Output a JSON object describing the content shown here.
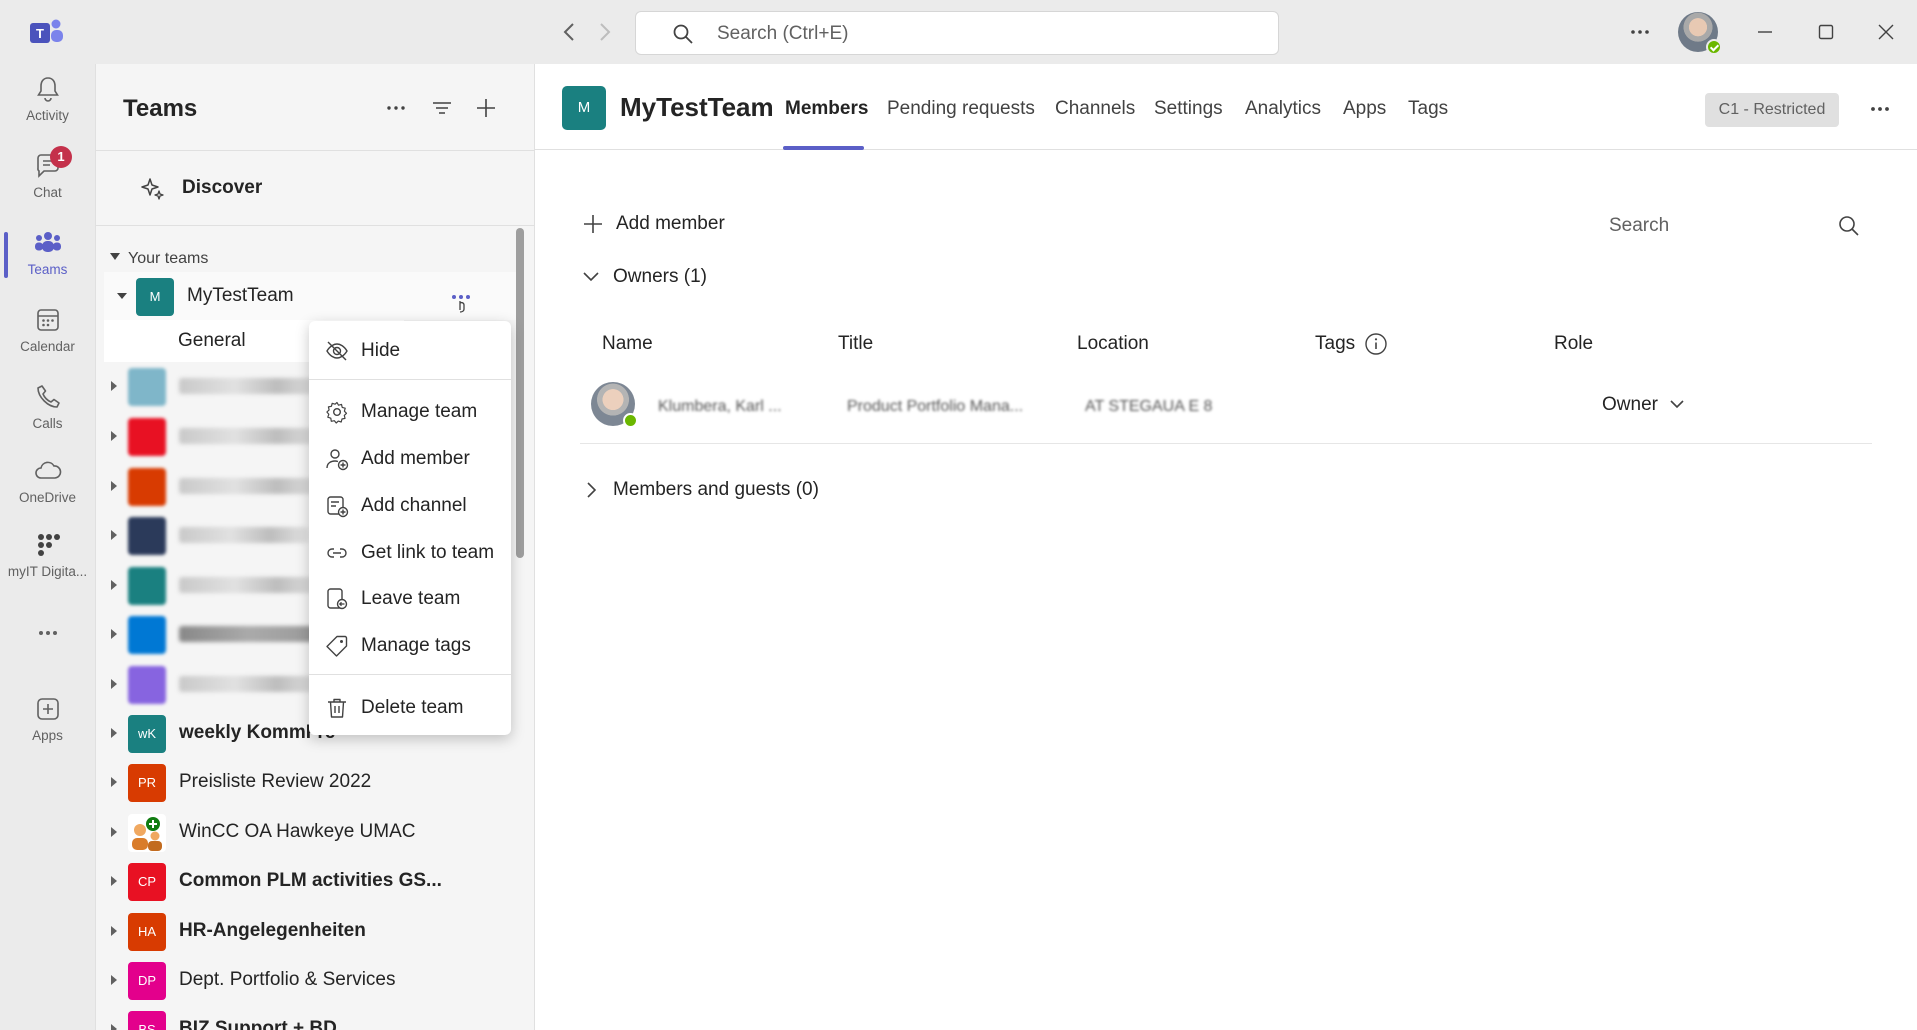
{
  "titlebar": {
    "search_placeholder": "Search (Ctrl+E)"
  },
  "rail": {
    "items": [
      {
        "label": "Activity",
        "icon": "bell-icon"
      },
      {
        "label": "Chat",
        "icon": "chat-icon",
        "badge": "1"
      },
      {
        "label": "Teams",
        "icon": "teams-icon",
        "active": true
      },
      {
        "label": "Calendar",
        "icon": "calendar-icon"
      },
      {
        "label": "Calls",
        "icon": "phone-icon"
      },
      {
        "label": "OneDrive",
        "icon": "cloud-icon"
      },
      {
        "label": "myIT Digita...",
        "icon": "app-grid-icon"
      },
      {
        "label": "Apps",
        "icon": "add-app-icon"
      }
    ]
  },
  "panel": {
    "title": "Teams",
    "discover_label": "Discover",
    "your_teams_label": "Your teams",
    "active_team": {
      "initials": "M",
      "name": "MyTestTeam",
      "color": "#1a8080"
    },
    "general_channel": "General",
    "teams": [
      {
        "initials": "wK",
        "name": "weekly KommFre",
        "color": "#1a8080",
        "bold": true
      },
      {
        "initials": "PR",
        "name": "Preisliste Review 2022",
        "color": "#d83b01",
        "bold": false
      },
      {
        "initials": "",
        "name": "WinCC OA Hawkeye UMAC",
        "color": "#ffffff",
        "bold": false
      },
      {
        "initials": "CP",
        "name": "Common PLM activities GS...",
        "color": "#e81123",
        "bold": true
      },
      {
        "initials": "HA",
        "name": "HR-Angelegenheiten",
        "color": "#d83b01",
        "bold": true
      },
      {
        "initials": "DP",
        "name": "Dept. Portfolio & Services",
        "color": "#e3008c",
        "bold": false
      },
      {
        "initials": "BS",
        "name": "BIZ Support + BD",
        "color": "#e3008c",
        "bold": true
      }
    ]
  },
  "context_menu": {
    "items": [
      {
        "label": "Hide",
        "icon": "hide-icon"
      },
      {
        "label": "Manage team",
        "icon": "gear-icon"
      },
      {
        "label": "Add member",
        "icon": "add-person-icon"
      },
      {
        "label": "Add channel",
        "icon": "add-channel-icon"
      },
      {
        "label": "Get link to team",
        "icon": "link-icon"
      },
      {
        "label": "Leave team",
        "icon": "leave-icon"
      },
      {
        "label": "Manage tags",
        "icon": "tag-icon"
      },
      {
        "label": "Delete team",
        "icon": "trash-icon"
      }
    ]
  },
  "main": {
    "team_initial": "M",
    "team_name": "MyTestTeam",
    "tabs": [
      "Members",
      "Pending requests",
      "Channels",
      "Settings",
      "Analytics",
      "Apps",
      "Tags"
    ],
    "active_tab": "Members",
    "sensitivity_label": "C1 - Restricted",
    "add_member_label": "Add member",
    "search_placeholder": "Search",
    "owners_section": "Owners (1)",
    "members_section": "Members and guests (0)",
    "columns": [
      "Name",
      "Title",
      "Location",
      "Tags",
      "Role"
    ],
    "owner": {
      "name": "Klumbera, Karl ...",
      "title": "Product Portfolio Mana...",
      "location": "AT STEGAUA E 8",
      "role": "Owner"
    }
  },
  "colors": {
    "accent": "#5b5fc7",
    "badge_red": "#c4314b",
    "presence_green": "#6bb700"
  }
}
